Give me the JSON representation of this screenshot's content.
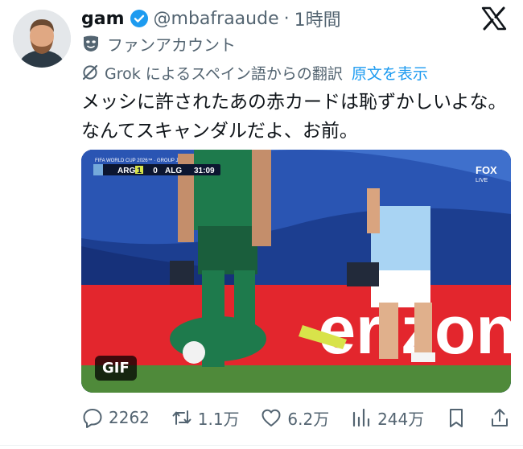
{
  "author": {
    "display_name": "gam",
    "handle": "@mbafraaude",
    "separator": "·",
    "time": "1時間",
    "fan_label": "ファンアカウント"
  },
  "translation": {
    "note": "Grok によるスペイン語からの翻訳",
    "show_original": "原文を表示"
  },
  "tweet": {
    "text": "メッシに許されたあの赤カードは恥ずかしいよな。なんてスキャンダルだよ、お前。"
  },
  "media": {
    "badge": "GIF",
    "scoreboard": {
      "competition": "FIFA WORLD CUP 2026™ · GROUP J",
      "team1": "ARG",
      "score1": "1",
      "score2": "0",
      "team2": "ALG",
      "clock": "31:09"
    },
    "broadcaster": "FOX",
    "broadcaster_sub": "LIVE",
    "board_text": "erizon"
  },
  "actions": {
    "replies": "2262",
    "reposts": "1.1万",
    "likes": "6.2万",
    "views": "244万"
  },
  "colors": {
    "link": "#1d9bf0",
    "muted": "#536471",
    "verified": "#1d9bf0",
    "board_red": "#e3262d"
  }
}
